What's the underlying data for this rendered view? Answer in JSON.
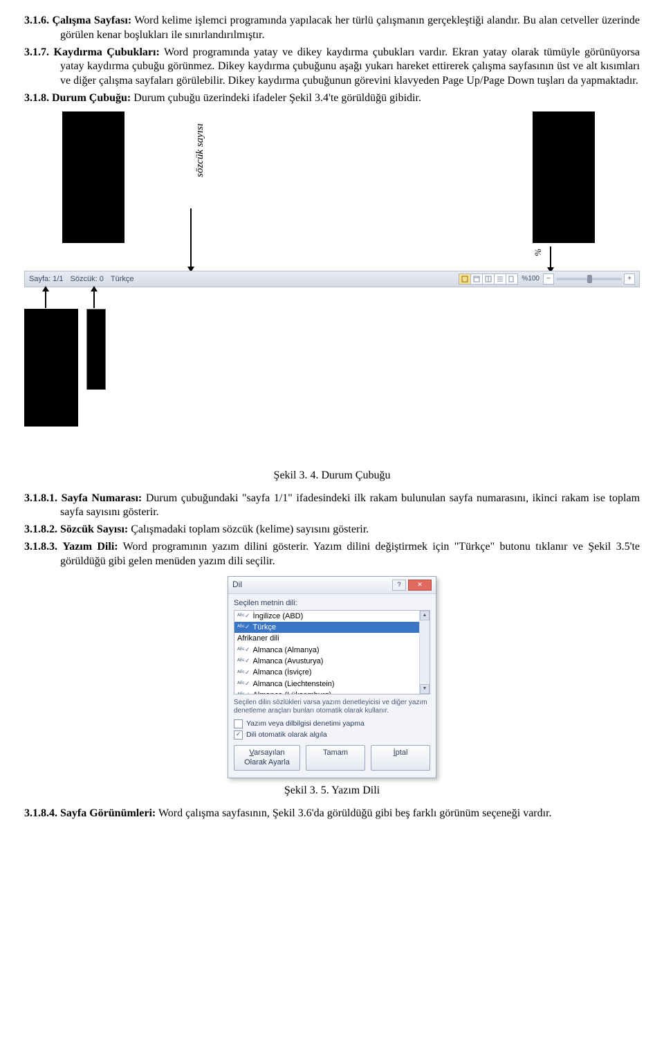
{
  "sections": {
    "s316": {
      "num": "3.1.6.",
      "title": "Çalışma Sayfası:",
      "text": " Word kelime işlemci programında yapılacak her türlü çalışmanın gerçekleştiği alandır. Bu alan cetveller üzerinde görülen kenar boşlukları ile sınırlandırılmıştır."
    },
    "s317": {
      "num": "3.1.7.",
      "title": "Kaydırma Çubukları:",
      "text": " Word programında yatay ve dikey kaydırma çubukları vardır. Ekran yatay olarak tümüyle görünüyorsa yatay kaydırma çubuğu görünmez. Dikey kaydırma çubuğunu aşağı yukarı hareket ettirerek çalışma sayfasının üst ve alt kısımları ve diğer çalışma sayfaları görülebilir. Dikey kaydırma çubuğunun görevini klavyeden Page Up/Page Down tuşları da yapmaktadır."
    },
    "s318": {
      "num": "3.1.8.",
      "title": "Durum Çubuğu:",
      "text": " Durum çubuğu üzerindeki ifadeler Şekil 3.4'te görüldüğü gibidir."
    },
    "s3181": {
      "num": "3.1.8.1.",
      "title": "Sayfa Numarası:",
      "text": " Durum çubuğundaki \"sayfa 1/1\" ifadesindeki ilk rakam bulunulan sayfa numarasını, ikinci rakam ise toplam sayfa sayısını gösterir."
    },
    "s3182": {
      "num": "3.1.8.2.",
      "title": "Sözcük Sayısı:",
      "text": " Çalışmadaki toplam sözcük (kelime) sayısını gösterir."
    },
    "s3183": {
      "num": "3.1.8.3.",
      "title": "Yazım Dili:",
      "text": " Word programının yazım dilini gösterir. Yazım dilini değiştirmek için \"Türkçe\" butonu tıklanır ve Şekil 3.5'te görüldüğü gibi gelen menüden yazım dili seçilir."
    },
    "s3184": {
      "num": "3.1.8.4.",
      "title": "Sayfa Görünümleri:",
      "text": " Word çalışma sayfasının, Şekil 3.6'da görüldüğü gibi beş farklı görünüm seçeneği vardır."
    }
  },
  "figure34": {
    "rotated_label": "sözcük sayısı",
    "pct_label": "%",
    "statusbar": {
      "page": "Sayfa: 1/1",
      "words": "Sözcük: 0",
      "lang": "Türkçe",
      "zoom": "%100",
      "minus": "−",
      "plus": "+"
    },
    "caption": "Şekil 3. 4. Durum Çubuğu"
  },
  "dialog": {
    "title": "Dil",
    "help": "?",
    "close": "✕",
    "label": "Seçilen metnin dili:",
    "languages": {
      "l0": "İngilizce (ABD)",
      "l1": "Türkçe",
      "l2": "Afrikaner dili",
      "l3": "Almanca (Almanya)",
      "l4": "Almanca (Avusturya)",
      "l5": "Almanca (İsviçre)",
      "l6": "Almanca (Liechtenstein)",
      "l7": "Almanca (Lüksemburg)"
    },
    "note": "Seçilen dilin sözlükleri varsa yazım denetleyicisi ve diğer yazım denetleme araçları bunları otomatik olarak kullanır.",
    "chk1": "Yazım veya dilbilgisi denetimi yapma",
    "chk2": "Dili otomatik olarak algıla",
    "chk2_mark": "✓",
    "btn_default": "Varsayılan Olarak Ayarla",
    "btn_ok": "Tamam",
    "btn_cancel": "İptal",
    "caption": "Şekil 3. 5. Yazım Dili"
  }
}
